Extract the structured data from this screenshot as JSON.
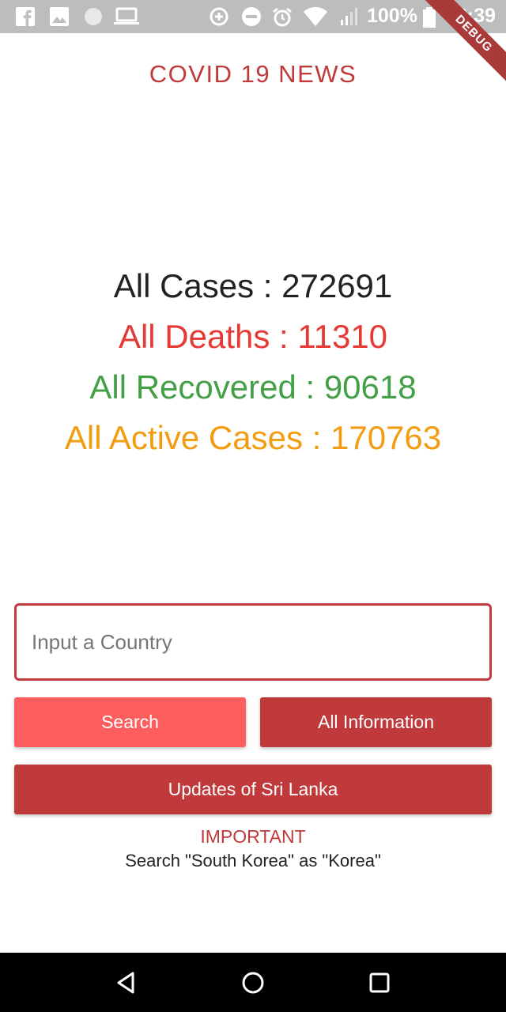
{
  "status_bar": {
    "battery_percent": "100%",
    "time": "02:39",
    "icons": [
      "facebook-icon",
      "image-icon",
      "circle-icon",
      "laptop-icon",
      "data-saver-icon",
      "do-not-disturb-icon",
      "alarm-icon",
      "wifi-icon",
      "signal-icon",
      "battery-icon"
    ]
  },
  "debug_banner": "DEBUG",
  "app_title": "COVID 19 NEWS",
  "stats": {
    "cases": {
      "label": "All Cases : 272691",
      "color": "#222222"
    },
    "deaths": {
      "label": "All Deaths : 11310",
      "color": "#e53935"
    },
    "recovered": {
      "label": "All Recovered : 90618",
      "color": "#43a047"
    },
    "active": {
      "label": "All Active Cases : 170763",
      "color": "#f39c12"
    }
  },
  "search": {
    "placeholder": "Input a Country",
    "value": ""
  },
  "buttons": {
    "search": "Search",
    "all_information": "All Information",
    "sri_lanka_updates": "Updates of Sri Lanka"
  },
  "notice": {
    "label": "IMPORTANT",
    "text": "Search \"South Korea\" as \"Korea\""
  },
  "colors": {
    "accent": "#c0393b",
    "search_button": "#ff5e5e"
  },
  "nav_bar": {
    "icons": [
      "back-icon",
      "home-icon",
      "recents-icon"
    ]
  }
}
